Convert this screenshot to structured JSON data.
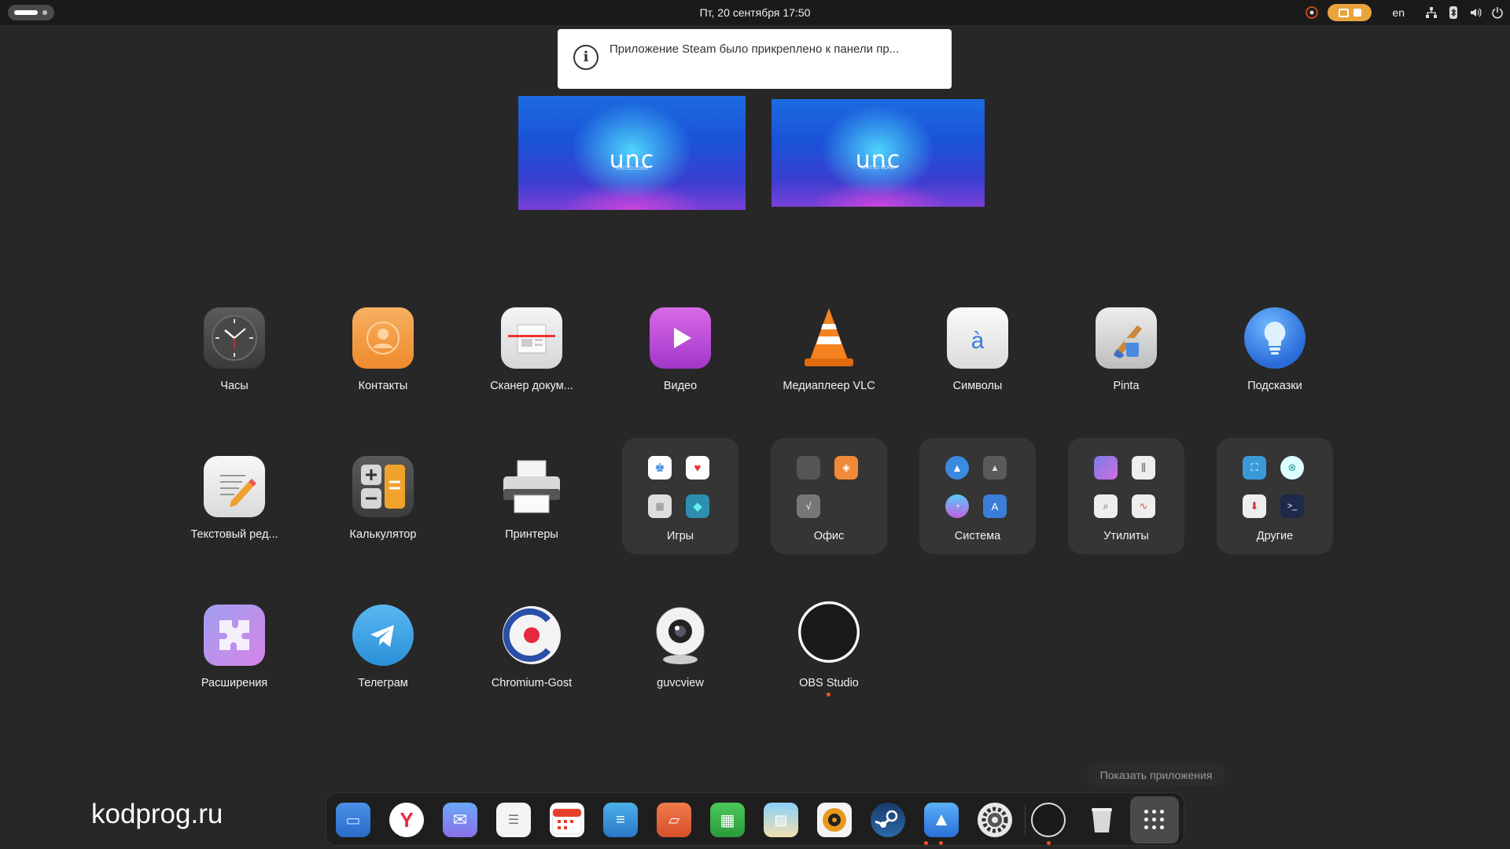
{
  "topbar": {
    "datetime": "Пт, 20 сентября  17:50",
    "lang": "en"
  },
  "notification": {
    "icon": "info-icon",
    "message": "Приложение Steam было прикреплено к панели пр..."
  },
  "previews": [
    {
      "logo": "unc",
      "sub": "UNITED CORE"
    },
    {
      "logo": "unc",
      "sub": "UNITED CORE"
    }
  ],
  "apps": [
    {
      "label": "Часы",
      "icon": "clock-icon"
    },
    {
      "label": "Контакты",
      "icon": "contacts-icon"
    },
    {
      "label": "Сканер докум...",
      "icon": "scanner-icon"
    },
    {
      "label": "Видео",
      "icon": "video-icon"
    },
    {
      "label": "Медиаплеер VLC",
      "icon": "vlc-icon"
    },
    {
      "label": "Символы",
      "icon": "characters-icon",
      "glyph": "à"
    },
    {
      "label": "Pinta",
      "icon": "pinta-icon"
    },
    {
      "label": "Подсказки",
      "icon": "tips-icon"
    },
    {
      "label": "Текстовый ред...",
      "icon": "text-editor-icon"
    },
    {
      "label": "Калькулятор",
      "icon": "calculator-icon"
    },
    {
      "label": "Принтеры",
      "icon": "printer-icon"
    },
    {
      "label": "Расширения",
      "icon": "extensions-icon"
    },
    {
      "label": "Телеграм",
      "icon": "telegram-icon"
    },
    {
      "label": "Chromium-Gost",
      "icon": "chromium-gost-icon"
    },
    {
      "label": "guvcview",
      "icon": "webcam-icon"
    },
    {
      "label": "OBS Studio",
      "icon": "obs-icon"
    }
  ],
  "folders": [
    {
      "label": "Игры"
    },
    {
      "label": "Офис"
    },
    {
      "label": "Система"
    },
    {
      "label": "Утилиты"
    },
    {
      "label": "Другие"
    }
  ],
  "dock": {
    "items": [
      "files-icon",
      "yandex-browser-icon",
      "mail-icon",
      "tasks-icon",
      "calendar-icon",
      "text-doc-icon",
      "presentation-icon",
      "spreadsheet-icon",
      "image-viewer-icon",
      "music-player-icon",
      "steam-icon",
      "software-center-icon",
      "settings-icon",
      "obs-icon",
      "trash-icon",
      "show-apps-icon"
    ],
    "tooltip": "Показать приложения"
  },
  "watermark": "kodprog.ru",
  "colors": {
    "accent": "#e95420",
    "background": "#272727",
    "topbar": "#1a1a1a"
  }
}
